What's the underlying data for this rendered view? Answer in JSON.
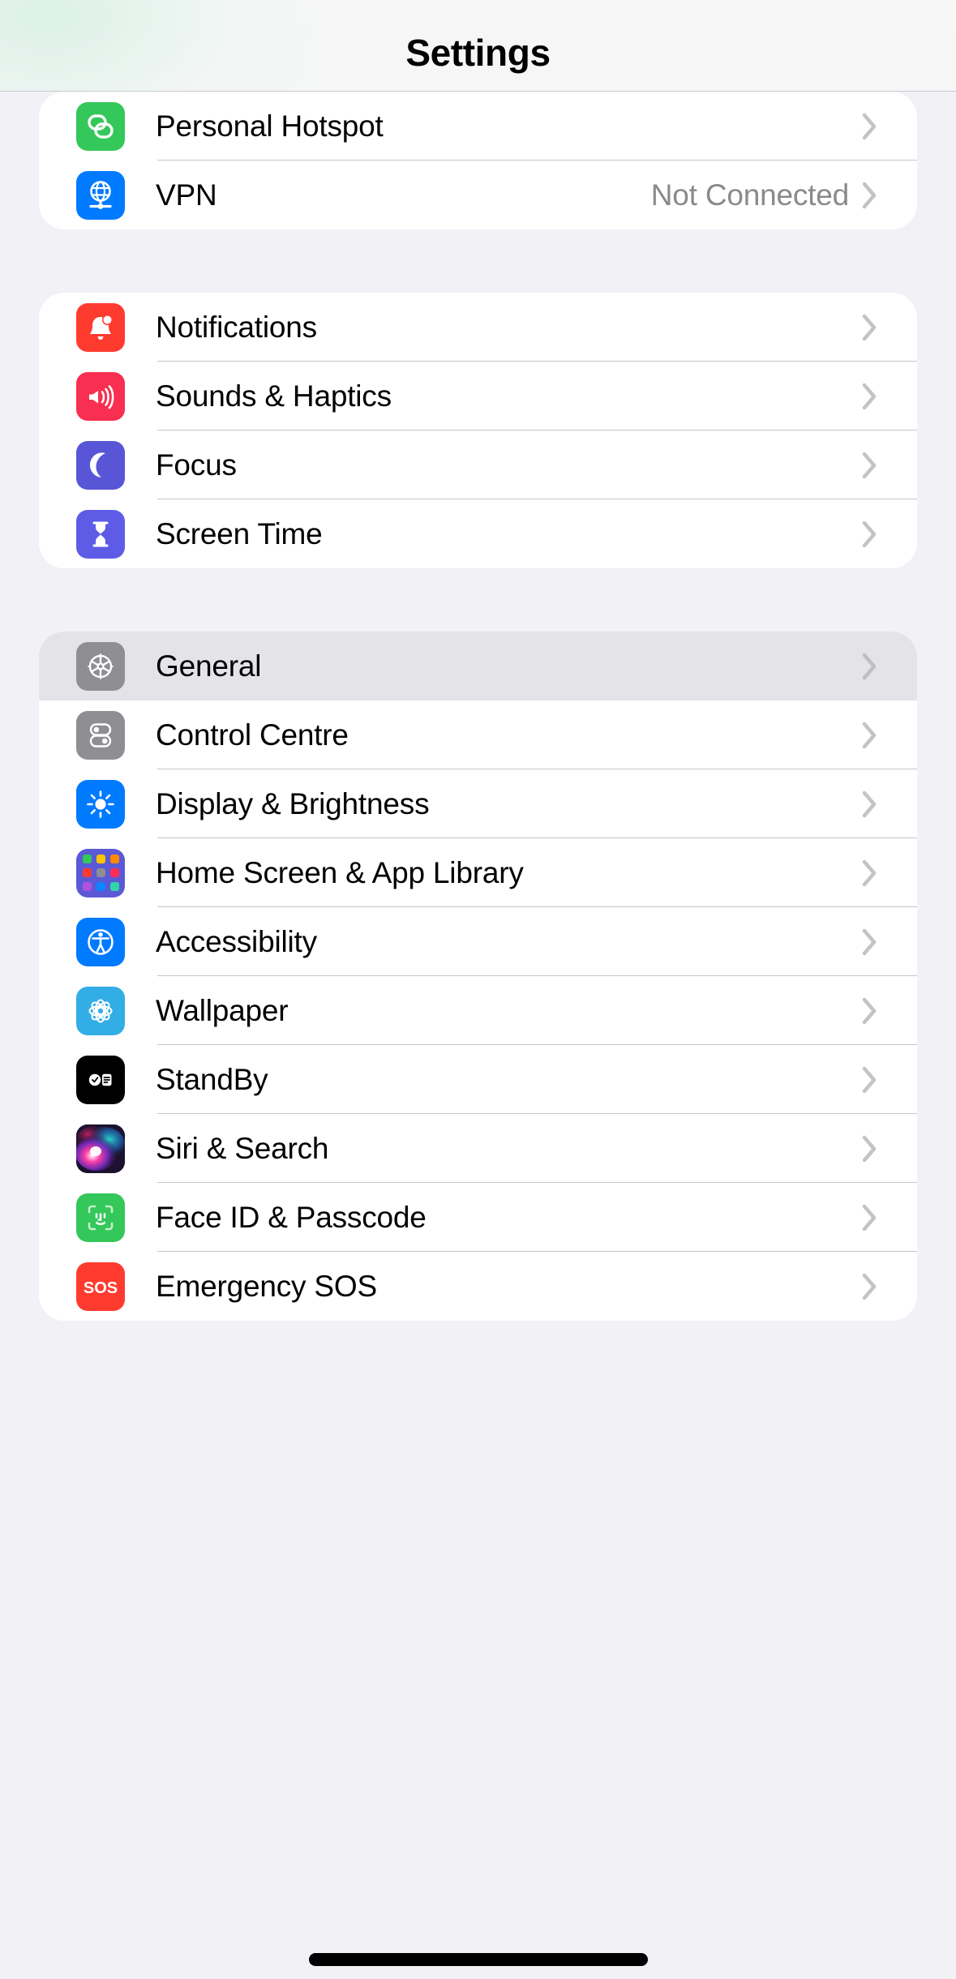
{
  "header": {
    "title": "Settings"
  },
  "colors": {
    "page_background": "#F2F1F6",
    "card_background": "#FFFFFF",
    "selected_row": "#E4E3E8",
    "separator": "#C6C6C8",
    "value_text": "#8A8A8E",
    "chevron": "#C4C4C6"
  },
  "sections": [
    {
      "id": "connectivity",
      "rows": [
        {
          "label": "Personal Hotspot",
          "value": "",
          "icon": "personal-hotspot-icon",
          "icon_color": "#34C759",
          "selected": false
        },
        {
          "label": "VPN",
          "value": "Not Connected",
          "icon": "vpn-globe-icon",
          "icon_color": "#007AFF",
          "selected": false
        }
      ]
    },
    {
      "id": "alerts",
      "rows": [
        {
          "label": "Notifications",
          "value": "",
          "icon": "notifications-bell-icon",
          "icon_color": "#FF3B30",
          "selected": false
        },
        {
          "label": "Sounds & Haptics",
          "value": "",
          "icon": "sounds-speaker-icon",
          "icon_color": "#F82F50",
          "selected": false
        },
        {
          "label": "Focus",
          "value": "",
          "icon": "focus-moon-icon",
          "icon_color": "#5856D6",
          "selected": false
        },
        {
          "label": "Screen Time",
          "value": "",
          "icon": "screen-time-hourglass-icon",
          "icon_color": "#5E5CE6",
          "selected": false
        }
      ]
    },
    {
      "id": "system",
      "rows": [
        {
          "label": "General",
          "value": "",
          "icon": "general-gear-icon",
          "icon_color": "#8E8E93",
          "selected": true
        },
        {
          "label": "Control Centre",
          "value": "",
          "icon": "control-centre-toggles-icon",
          "icon_color": "#8E8E93",
          "selected": false
        },
        {
          "label": "Display & Brightness",
          "value": "",
          "icon": "display-brightness-sun-icon",
          "icon_color": "#007AFF",
          "selected": false
        },
        {
          "label": "Home Screen & App Library",
          "value": "",
          "icon": "home-screen-grid-icon",
          "icon_color": "#5B59D6",
          "selected": false
        },
        {
          "label": "Accessibility",
          "value": "",
          "icon": "accessibility-person-icon",
          "icon_color": "#007AFF",
          "selected": false
        },
        {
          "label": "Wallpaper",
          "value": "",
          "icon": "wallpaper-flower-icon",
          "icon_color": "#32ADE6",
          "selected": false
        },
        {
          "label": "StandBy",
          "value": "",
          "icon": "standby-clock-icon",
          "icon_color": "#000000",
          "selected": false
        },
        {
          "label": "Siri & Search",
          "value": "",
          "icon": "siri-orb-icon",
          "icon_color": "#2A1A2E",
          "selected": false
        },
        {
          "label": "Face ID & Passcode",
          "value": "",
          "icon": "face-id-icon",
          "icon_color": "#34C759",
          "selected": false
        },
        {
          "label": "Emergency SOS",
          "value": "",
          "icon": "emergency-sos-icon",
          "icon_color": "#FF3B30",
          "selected": false
        }
      ]
    }
  ],
  "home_indicator": {
    "present": true
  }
}
